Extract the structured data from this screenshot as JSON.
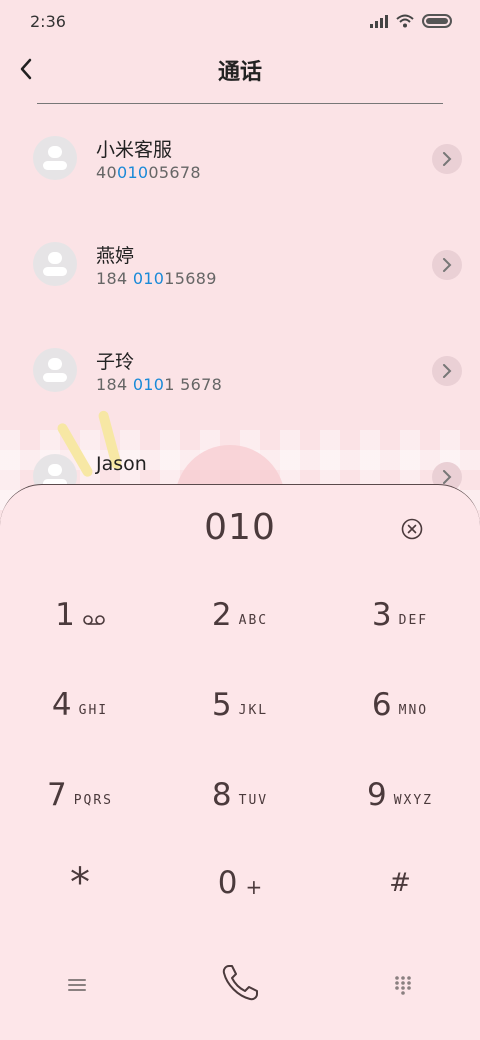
{
  "status_bar": {
    "time": "2:36"
  },
  "header": {
    "title": "通话"
  },
  "contacts": [
    {
      "name": "小米客服",
      "number_pre": "40",
      "number_match": "010",
      "number_post": "05678"
    },
    {
      "name": "燕婷",
      "number_pre": "184 ",
      "number_match": "010",
      "number_post": "15689"
    },
    {
      "name": "子玲",
      "number_pre": "184 ",
      "number_match": "010",
      "number_post": "1 5678"
    },
    {
      "name": "Jason",
      "number_pre": "",
      "number_match": "",
      "number_post": ""
    }
  ],
  "dialer": {
    "input": "010",
    "keys": [
      {
        "digit": "1",
        "letters": "",
        "symbol": "voicemail"
      },
      {
        "digit": "2",
        "letters": "ABC"
      },
      {
        "digit": "3",
        "letters": "DEF"
      },
      {
        "digit": "4",
        "letters": "GHI"
      },
      {
        "digit": "5",
        "letters": "JKL"
      },
      {
        "digit": "6",
        "letters": "MNO"
      },
      {
        "digit": "7",
        "letters": "PQRS"
      },
      {
        "digit": "8",
        "letters": "TUV"
      },
      {
        "digit": "9",
        "letters": "WXYZ"
      },
      {
        "digit": "*",
        "letters": ""
      },
      {
        "digit": "0",
        "letters": "+"
      },
      {
        "digit": "#",
        "letters": ""
      }
    ]
  },
  "colors": {
    "highlight": "#1a8ad8",
    "background": "#fbe3e6",
    "dialer_text": "#4b3a3c"
  },
  "icons": {
    "back": "chevron-left-icon",
    "detail": "chevron-right-icon",
    "clear": "clear-circle-x-icon",
    "menu": "menu-lines-icon",
    "call": "phone-icon",
    "keypad": "dialpad-grid-icon",
    "voicemail": "voicemail-icon"
  }
}
